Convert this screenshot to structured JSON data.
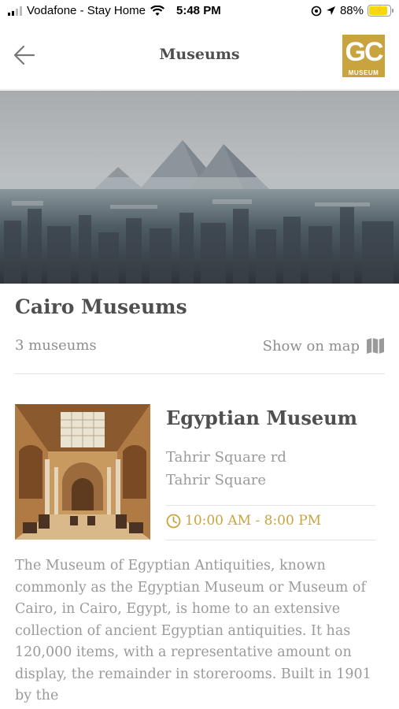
{
  "status_bar": {
    "carrier": "Vodafone - Stay Home",
    "time": "5:48 PM",
    "battery": "88%",
    "battery_fraction": 0.88
  },
  "nav": {
    "title": "Museums",
    "logo_letters": "GC",
    "logo_word": "MUSEUM",
    "back_icon": "arrow-left-icon"
  },
  "section": {
    "title": "Cairo Museums",
    "count": "3 museums",
    "map_link": "Show on map",
    "map_icon": "map-icon"
  },
  "museum": {
    "name": "Egyptian Museum",
    "address_line1": "Tahrir Square rd",
    "address_line2": "Tahrir Square",
    "hours": "10:00 AM - 8:00 PM",
    "clock_icon": "clock-icon",
    "description": "The Museum of Egyptian Antiquities, known commonly as the Egyptian Museum or Museum of Cairo, in Cairo, Egypt, is home to an extensive collection of ancient Egyptian antiquities. It has 120,000 items, with a representative amount on display, the remainder in storerooms. Built in 1901 by the"
  },
  "colors": {
    "accent": "#c9a33e",
    "title_text": "#4f4f4f",
    "muted_text": "#9a9a9a",
    "divider": "#e3e3e3"
  }
}
